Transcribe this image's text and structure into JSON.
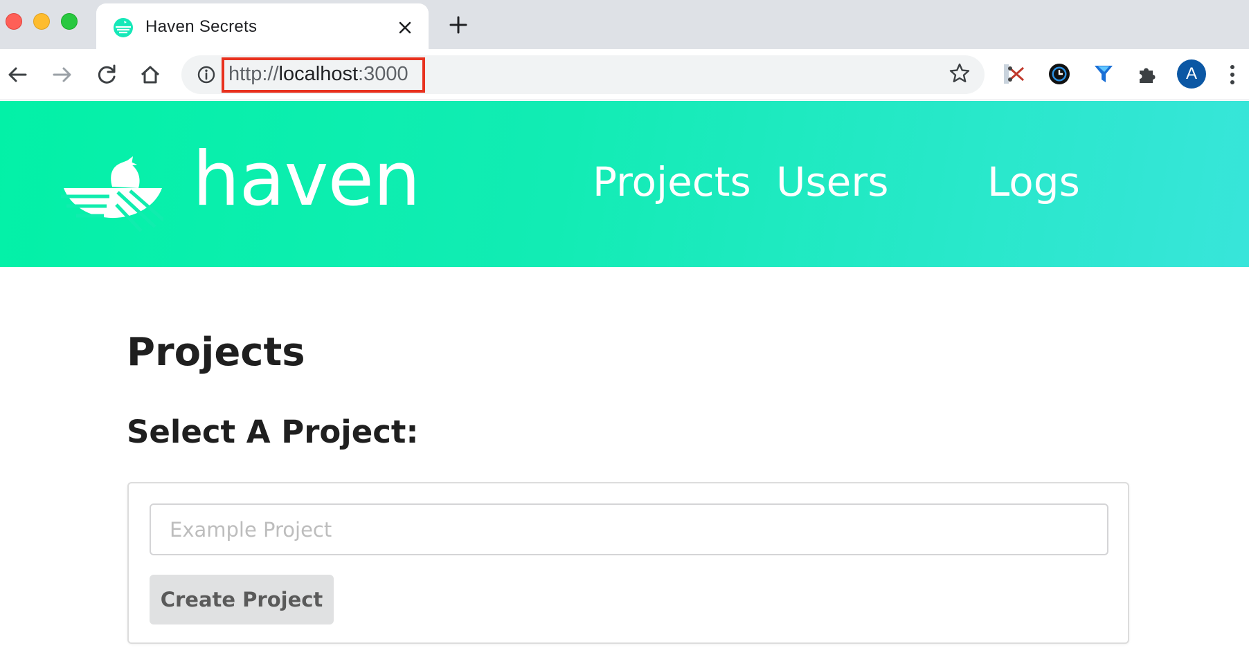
{
  "browser": {
    "tab": {
      "title": "Haven Secrets",
      "favicon": "haven-bird-icon"
    },
    "address": {
      "scheme": "http://",
      "host": "localhost",
      "port": ":3000"
    },
    "highlight_color": "#e8311e",
    "avatar_letter": "A",
    "toolbar_icons": [
      "back-arrow-icon",
      "forward-arrow-icon",
      "reload-icon",
      "home-icon",
      "info-icon",
      "star-icon"
    ],
    "extension_icons": [
      "scissors-extension-icon",
      "clock-extension-icon",
      "funnel-extension-icon",
      "puzzle-extensions-icon"
    ]
  },
  "header": {
    "brand": "haven",
    "nav": [
      {
        "label": "Projects"
      },
      {
        "label": "Users"
      },
      {
        "label": "Logs"
      }
    ],
    "gradient": [
      "#03f1a7",
      "#38e5da"
    ]
  },
  "main": {
    "title": "Projects",
    "section_title": "Select A Project:",
    "input_placeholder": "Example Project",
    "create_button": "Create Project"
  }
}
